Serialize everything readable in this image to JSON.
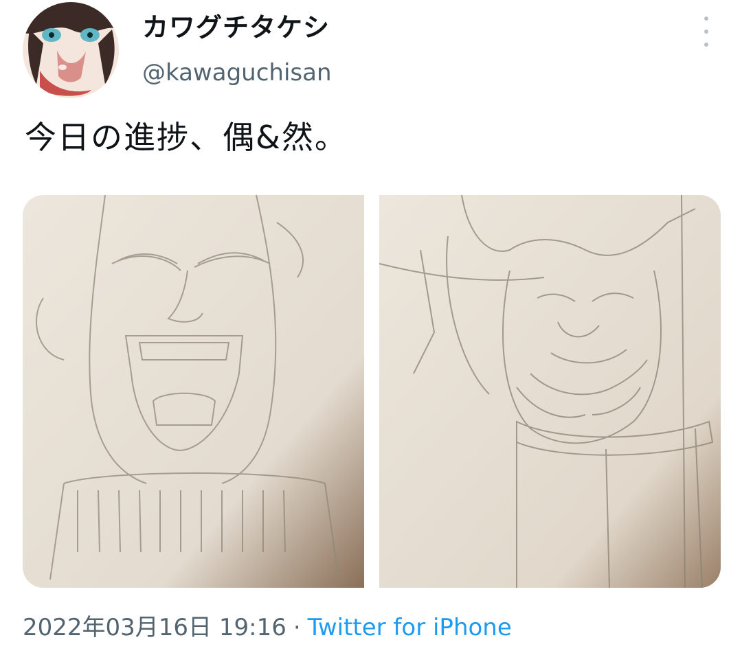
{
  "tweet": {
    "author": {
      "display_name": "カワグチタケシ",
      "handle": "@kawaguchisan",
      "avatar_icon": "avatar-illustration"
    },
    "more_icon": "more-vertical-icon",
    "text": "今日の進捗、偶&然。",
    "media": [
      {
        "kind": "photo",
        "subject": "pencil sketch of shouting man"
      },
      {
        "kind": "photo",
        "subject": "pencil sketch of beast warrior"
      }
    ],
    "timestamp": "2022年03月16日 19:16",
    "separator": "·",
    "source": "Twitter for iPhone"
  },
  "colors": {
    "text_primary": "#0f1419",
    "text_secondary": "#536471",
    "link": "#1d9bf0",
    "paper": "#e9e2d7"
  }
}
